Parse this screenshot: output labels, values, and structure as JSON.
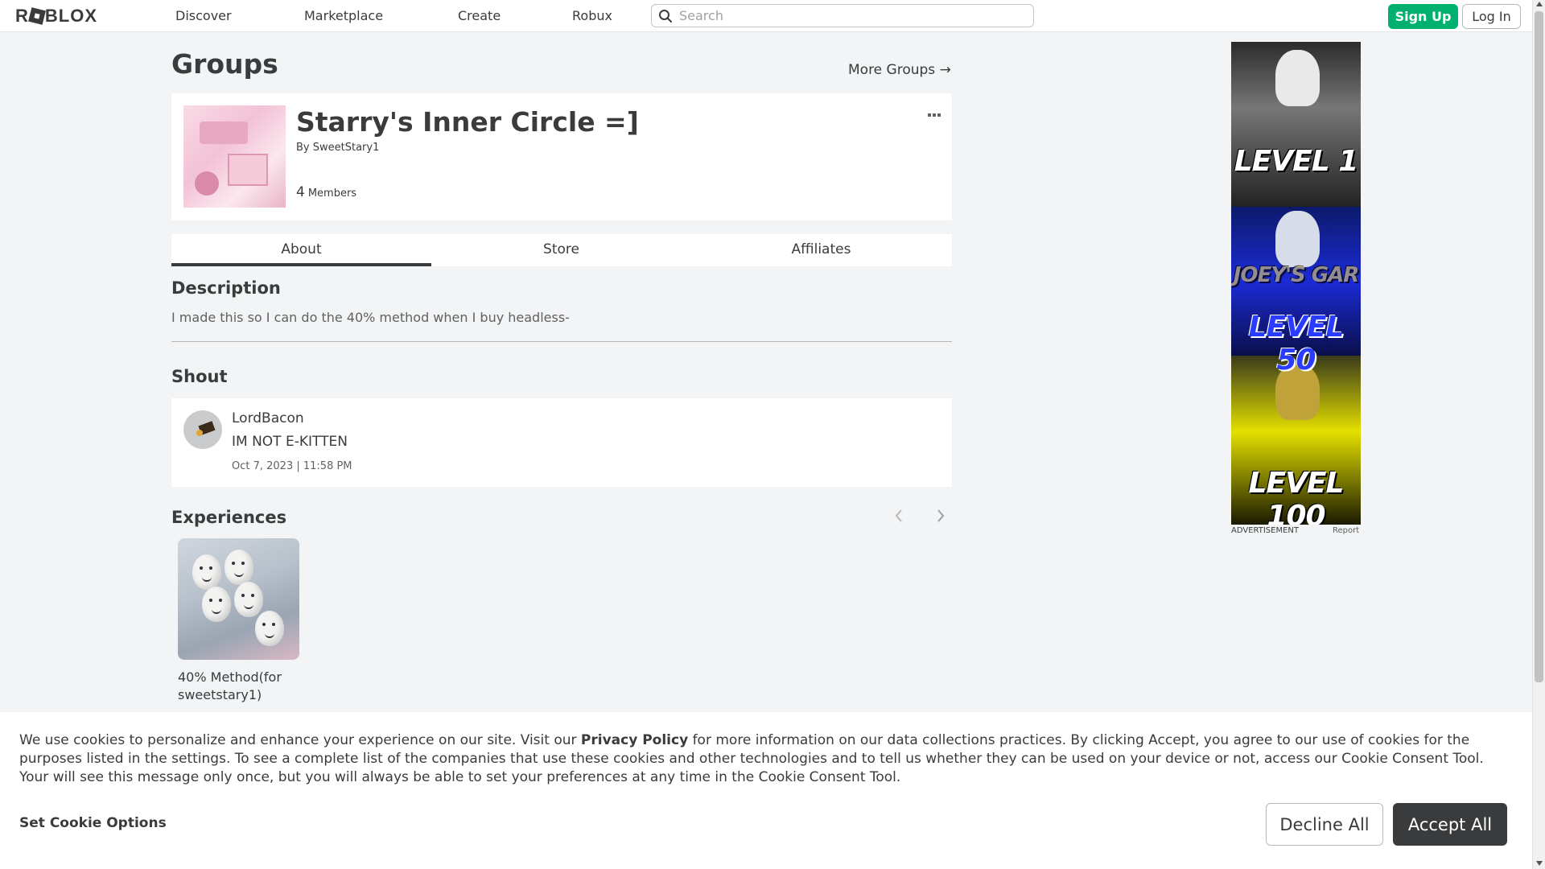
{
  "header": {
    "logo": "ROBLOX",
    "nav": [
      {
        "label": "Discover"
      },
      {
        "label": "Marketplace"
      },
      {
        "label": "Create"
      },
      {
        "label": "Robux"
      }
    ],
    "search_placeholder": "Search",
    "signup_label": "Sign Up",
    "login_label": "Log In",
    "signup_color": "#00b06f"
  },
  "page": {
    "title": "Groups",
    "more_groups_label": "More Groups →"
  },
  "group": {
    "name": "Starry's Inner Circle =]",
    "by_label": "By",
    "owner": "SweetStary1",
    "member_count": "4",
    "members_label": "Members"
  },
  "tabs": [
    {
      "label": "About",
      "active": true
    },
    {
      "label": "Store",
      "active": false
    },
    {
      "label": "Affiliates",
      "active": false
    }
  ],
  "about": {
    "description_title": "Description",
    "description": "I made this so I can do the 40% method when I buy headless-",
    "shout_title": "Shout",
    "shout": {
      "user": "LordBacon",
      "message": "IM NOT E-KITTEN",
      "timestamp": "Oct 7, 2023 | 11:58 PM"
    },
    "experiences_title": "Experiences",
    "experiences": [
      {
        "name": "40% Method(for sweetstary1)"
      }
    ]
  },
  "ad": {
    "texts": [
      "LEVEL 1",
      "JOEY'S GAR",
      "LEVEL 50",
      "LEVEL 100"
    ],
    "label": "ADVERTISEMENT",
    "report": "Report"
  },
  "cookie": {
    "text_before": "We use cookies to personalize and enhance your experience on our site. Visit our ",
    "policy_link": "Privacy Policy",
    "text_after": " for more information on our data collections practices. By clicking Accept, you agree to our use of cookies for the purposes listed in the settings. To see a complete list of the companies that use these cookies and other technologies and to tell us whether they can be used on your device or not, access our Cookie Consent Tool. Your will see this message only once, but you will always be able to set your preferences at any time in the Cookie Consent Tool.",
    "set_options": "Set Cookie Options",
    "decline": "Decline All",
    "accept": "Accept All"
  }
}
